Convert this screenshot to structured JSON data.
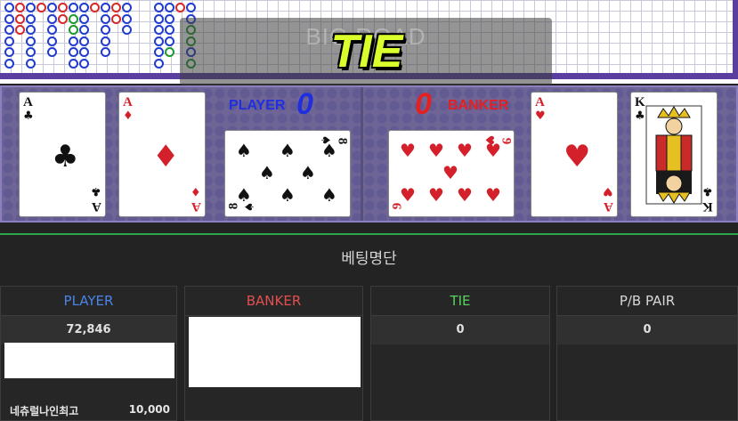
{
  "board": {
    "title": "BIG ROAD",
    "colors": {
      "player": "#1f3bd0",
      "banker": "#d72828",
      "tie": "#1c9a2c"
    }
  },
  "result": {
    "banner": "TIE"
  },
  "player": {
    "label": "PLAYER",
    "score": "0"
  },
  "banker": {
    "label": "BANKER",
    "score": "0"
  },
  "cards": {
    "player": [
      {
        "rank": "A",
        "suit": "clubs",
        "symbol": "♣"
      },
      {
        "rank": "A",
        "suit": "diamonds",
        "symbol": "♦"
      },
      {
        "rank": "8",
        "suit": "spades",
        "symbol": "♠"
      }
    ],
    "banker": [
      {
        "rank": "9",
        "suit": "hearts",
        "symbol": "♥"
      },
      {
        "rank": "A",
        "suit": "hearts",
        "symbol": "♥"
      },
      {
        "rank": "K",
        "suit": "clubs",
        "symbol": "♣"
      }
    ]
  },
  "betting": {
    "title": "베팅명단",
    "columns": {
      "player": {
        "label": "PLAYER",
        "total": "72,846"
      },
      "banker": {
        "label": "BANKER",
        "total": ""
      },
      "tie": {
        "label": "TIE",
        "total": "0"
      },
      "pair": {
        "label": "P/B PAIR",
        "total": "0"
      }
    },
    "player_bettors": [
      {
        "name": "네츄럴나인최고",
        "amount": "10,000"
      }
    ]
  }
}
